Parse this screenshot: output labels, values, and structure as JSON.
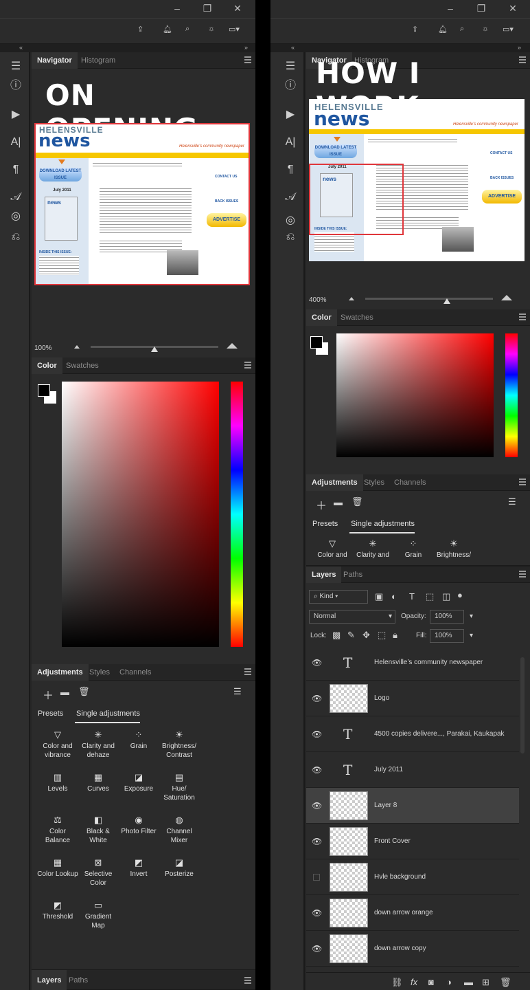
{
  "left": {
    "title_text": "ON OPENING",
    "nav_tabs": [
      "Navigator",
      "Histogram"
    ],
    "zoom": "100%",
    "color_tabs": [
      "Color",
      "Swatches"
    ],
    "adj_tabs": [
      "Adjustments",
      "Styles",
      "Channels"
    ],
    "adj_subtabs": [
      "Presets",
      "Single adjustments"
    ],
    "adjustments": [
      {
        "icon": "▽",
        "label": "Color and vibrance"
      },
      {
        "icon": "✳",
        "label": "Clarity and dehaze"
      },
      {
        "icon": "⁘",
        "label": "Grain"
      },
      {
        "icon": "☀",
        "label": "Brightness/ Contrast"
      },
      {
        "icon": "▥",
        "label": "Levels"
      },
      {
        "icon": "▦",
        "label": "Curves"
      },
      {
        "icon": "◪",
        "label": "Exposure"
      },
      {
        "icon": "▤",
        "label": "Hue/ Saturation"
      },
      {
        "icon": "⚖",
        "label": "Color Balance"
      },
      {
        "icon": "◧",
        "label": "Black & White"
      },
      {
        "icon": "◉",
        "label": "Photo Filter"
      },
      {
        "icon": "◍",
        "label": "Channel Mixer"
      },
      {
        "icon": "▦",
        "label": "Color Lookup"
      },
      {
        "icon": "⊠",
        "label": "Selective Color"
      },
      {
        "icon": "◩",
        "label": "Invert"
      },
      {
        "icon": "◪",
        "label": "Posterize"
      },
      {
        "icon": "◩",
        "label": "Threshold"
      },
      {
        "icon": "▭",
        "label": "Gradient Map"
      }
    ],
    "layers_tabs": [
      "Layers",
      "Paths"
    ]
  },
  "right": {
    "title_text": "HOW I WORK",
    "nav_tabs": [
      "Navigator",
      "Histogram"
    ],
    "zoom": "400%",
    "color_tabs": [
      "Color",
      "Swatches"
    ],
    "adj_tabs": [
      "Adjustments",
      "Styles",
      "Channels"
    ],
    "adj_subtabs": [
      "Presets",
      "Single adjustments"
    ],
    "adjustments": [
      {
        "icon": "▽",
        "label": "Color and"
      },
      {
        "icon": "✳",
        "label": "Clarity and"
      },
      {
        "icon": "⁘",
        "label": "Grain"
      },
      {
        "icon": "☀",
        "label": "Brightness/"
      }
    ],
    "layers_tabs": [
      "Layers",
      "Paths"
    ],
    "kind_label": "Kind",
    "blend_mode": "Normal",
    "opacity_label": "Opacity:",
    "opacity_value": "100%",
    "lock_label": "Lock:",
    "fill_label": "Fill:",
    "fill_value": "100%",
    "layers": [
      {
        "type": "text",
        "name": "Helensville’s community newspaper",
        "visible": true
      },
      {
        "type": "image",
        "name": "Logo",
        "visible": true
      },
      {
        "type": "text",
        "name": "4500 copies delivere..., Parakai, Kaukapak",
        "visible": true
      },
      {
        "type": "text",
        "name": "July 2011",
        "visible": true
      },
      {
        "type": "image",
        "name": "Layer 8",
        "visible": true,
        "selected": true
      },
      {
        "type": "image",
        "name": "Front Cover",
        "visible": true
      },
      {
        "type": "image",
        "name": "Hvle background",
        "visible": false
      },
      {
        "type": "image",
        "name": "down arrow orange",
        "visible": true
      },
      {
        "type": "image",
        "name": "down arrow copy",
        "visible": true
      }
    ]
  },
  "doc": {
    "masthead_top": "HELENSVILLE",
    "masthead_main": "news",
    "tagline": "Helensville’s community newspaper",
    "date": "July 2011",
    "download_btn": "DOWNLOAD LATEST ISSUE",
    "advertise_btn": "ADVERTISE",
    "contact": "CONTACT US",
    "back_issues": "BACK ISSUES",
    "inside": "INSIDE THIS ISSUE:"
  },
  "colors": {
    "panel": "#2b2b2b",
    "accent_red": "#e0363b",
    "news_blue": "#1f56a0",
    "yellow": "#f6c700"
  }
}
